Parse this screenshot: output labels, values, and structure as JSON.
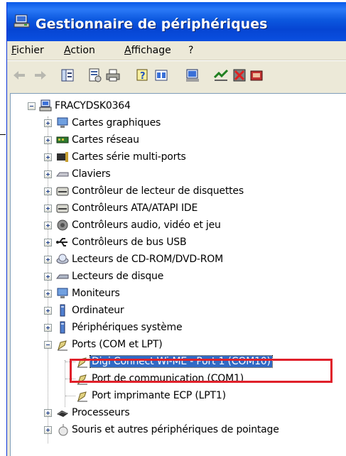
{
  "window": {
    "title": "Gestionnaire de périphériques",
    "title_icon": "device-manager-icon",
    "colors": {
      "titlebar": "#0a5ae8",
      "selection": "#316ac5",
      "highlight_box": "#e0202a"
    }
  },
  "menu": {
    "items": [
      {
        "label": "Fichier"
      },
      {
        "label": "Action"
      },
      {
        "label": "Affichage"
      },
      {
        "label": "?"
      }
    ]
  },
  "toolbar": {
    "buttons": [
      "back-icon",
      "forward-icon",
      "properties-pane-icon",
      "properties-icon",
      "print-icon",
      "help-icon",
      "view-icon",
      "scan-hardware-icon",
      "update-driver-icon",
      "disable-icon",
      "uninstall-icon"
    ]
  },
  "tree": {
    "root": "FRACYDSK0364",
    "categories": [
      {
        "label": "Cartes graphiques",
        "icon": "display-adapter-icon"
      },
      {
        "label": "Cartes réseau",
        "icon": "network-adapter-icon"
      },
      {
        "label": "Cartes série multi-ports",
        "icon": "multiport-serial-icon"
      },
      {
        "label": "Claviers",
        "icon": "keyboard-icon"
      },
      {
        "label": "Contrôleur de lecteur de disquettes",
        "icon": "floppy-controller-icon"
      },
      {
        "label": "Contrôleurs ATA/ATAPI IDE",
        "icon": "ide-controller-icon"
      },
      {
        "label": "Contrôleurs audio, vidéo et jeu",
        "icon": "sound-icon"
      },
      {
        "label": "Contrôleurs de bus USB",
        "icon": "usb-icon"
      },
      {
        "label": "Lecteurs de CD-ROM/DVD-ROM",
        "icon": "cdrom-icon"
      },
      {
        "label": "Lecteurs de disque",
        "icon": "disk-drive-icon"
      },
      {
        "label": "Moniteurs",
        "icon": "monitor-icon"
      },
      {
        "label": "Ordinateur",
        "icon": "computer-icon"
      },
      {
        "label": "Périphériques système",
        "icon": "system-device-icon"
      },
      {
        "label": "Ports (COM et LPT)",
        "icon": "port-icon",
        "expanded": true
      }
    ],
    "ports_children": [
      {
        "label": "Digi Connect Wi-ME - Port 1 (COM10)",
        "selected": true
      },
      {
        "label": "Port de communication (COM1)"
      },
      {
        "label": "Port imprimante ECP (LPT1)"
      }
    ],
    "after_ports": [
      {
        "label": "Processeurs",
        "icon": "processor-icon"
      },
      {
        "label": "Souris et autres périphériques de pointage",
        "icon": "mouse-icon"
      }
    ]
  }
}
